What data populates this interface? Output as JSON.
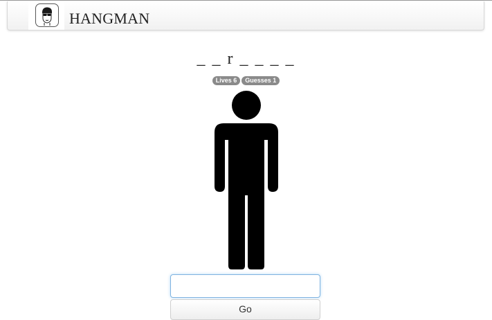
{
  "app": {
    "title": "HANGMAN",
    "logo_icon": "man-with-sunglasses-icon"
  },
  "game": {
    "word_display": "_ _ r _ _ _ _",
    "lives_label": "Lives 6",
    "guesses_label": "Guesses 1",
    "figure_icon": "person-figure-icon"
  },
  "guess_form": {
    "input_value": "",
    "submit_label": "Go"
  },
  "colors": {
    "figure": "#000000",
    "badge": "#8a8a8a",
    "input_focus": "#7fb3e0"
  }
}
